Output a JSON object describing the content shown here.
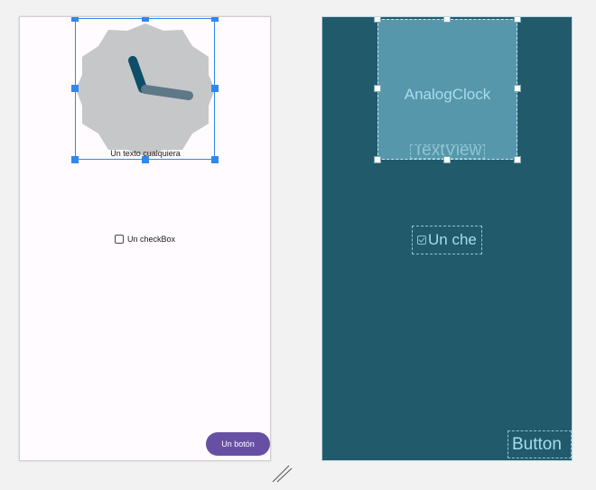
{
  "design_view": {
    "textview_text": "Un texto cualquiera",
    "checkbox_label": "Un checkBox",
    "button_label": "Un botón"
  },
  "blueprint_view": {
    "clock_label": "AnalogClock",
    "textview_label": "TextView",
    "checkbox_label": "Un che",
    "button_label": "Button"
  },
  "colors": {
    "design_background": "#fffbfe",
    "selection_blue": "#2f87f0",
    "button_purple": "#6750a4",
    "blueprint_background": "#215a6b",
    "blueprint_selected": "#5697ab",
    "clock_face": "#c6c7c9",
    "clock_hand_hour": "#0d4f68",
    "clock_hand_minute": "#5d7886"
  },
  "icons": [
    "analog-clock-icon",
    "checkbox-icon",
    "resize-grip-icon"
  ]
}
